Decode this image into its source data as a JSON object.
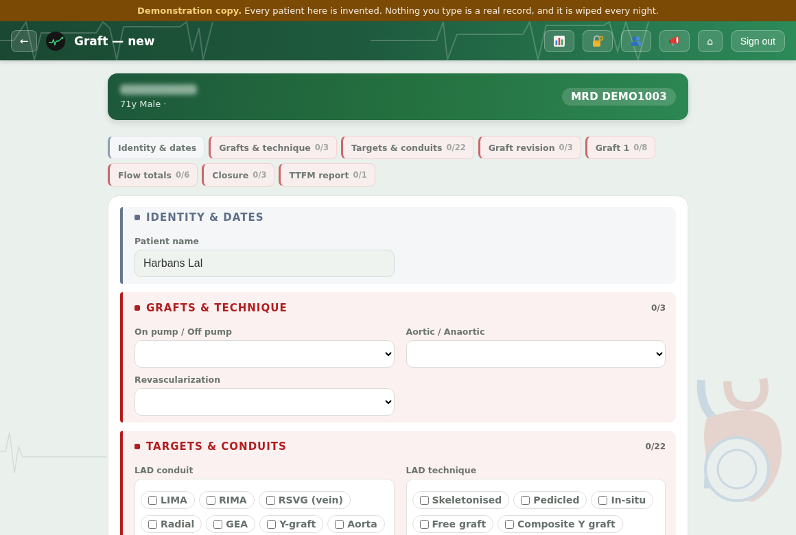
{
  "banner": {
    "text": "**Demonstration copy.** Every patient here is invented. Nothing you type is a real record, and it is wiped every night."
  },
  "header": {
    "back_button": "←",
    "title": "Graft — new",
    "home_button": "⌂",
    "sign_out_button": "Sign out"
  },
  "patient": {
    "details": "71y Male ·",
    "mrd": "MRD DEMO1003"
  },
  "tabs": [
    {
      "label": "Identity & dates",
      "incomplete": false
    },
    {
      "label": "Grafts & technique",
      "count": "0/3",
      "incomplete": true
    },
    {
      "label": "Targets & conduits",
      "count": "0/22",
      "incomplete": true
    },
    {
      "label": "Graft revision",
      "count": "0/3",
      "incomplete": true
    },
    {
      "label": "Graft 1",
      "count": "0/8",
      "incomplete": true
    },
    {
      "label": "Flow totals",
      "count": "0/6",
      "incomplete": true
    },
    {
      "label": "Closure",
      "count": "0/3",
      "incomplete": true
    },
    {
      "label": "TTFM report",
      "count": "0/1",
      "incomplete": true
    }
  ],
  "sections": [
    {
      "title": "IDENTITY & DATES",
      "incomplete": false,
      "fields": [
        {
          "kind": "text",
          "label": "Patient name",
          "value": "Harbans Lal"
        }
      ]
    },
    {
      "title": "GRAFTS & TECHNIQUE",
      "count": "0/3",
      "incomplete": true,
      "fields": [
        {
          "kind": "select",
          "label": "On pump / Off pump"
        },
        {
          "kind": "select",
          "label": "Aortic / Anaortic"
        },
        {
          "kind": "select",
          "label": "Revascularization"
        }
      ]
    },
    {
      "title": "TARGETS & CONDUITS",
      "count": "0/22",
      "incomplete": true,
      "fields": [
        {
          "kind": "checks",
          "label": "LAD conduit",
          "options": [
            {
              "label": "LIMA",
              "checked": false
            },
            {
              "label": "RIMA",
              "checked": false
            },
            {
              "label": "RSVG (vein)",
              "checked": false
            },
            {
              "label": "Radial",
              "checked": false
            },
            {
              "label": "GEA",
              "checked": false
            },
            {
              "label": "Y-graft",
              "checked": false
            },
            {
              "label": "Aorta",
              "checked": false
            }
          ]
        },
        {
          "kind": "checks",
          "label": "LAD technique",
          "options": [
            {
              "label": "Skeletonised",
              "checked": false
            },
            {
              "label": "Pedicled",
              "checked": false
            },
            {
              "label": "In-situ",
              "checked": false
            },
            {
              "label": "Free graft",
              "checked": false
            },
            {
              "label": "Composite Y graft",
              "checked": false
            }
          ]
        }
      ]
    }
  ]
}
